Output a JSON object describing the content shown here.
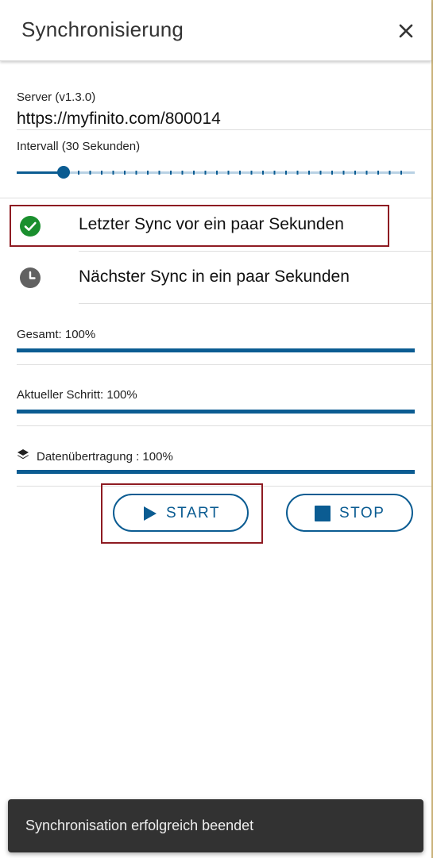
{
  "header": {
    "title": "Synchronisierung",
    "close_icon": "close-icon"
  },
  "server": {
    "label": "Server (v1.3.0)",
    "url": "https://myfinito.com/800014"
  },
  "interval": {
    "label": "Intervall (30 Sekunden)",
    "value_seconds": 30
  },
  "status": {
    "last_sync": {
      "icon": "check-circle-icon",
      "text": "Letzter Sync vor ein paar Sekunden",
      "color": "#1a8f2e"
    },
    "next_sync": {
      "icon": "clock-icon",
      "text": "Nächster Sync in ein paar Sekunden",
      "color": "#616161"
    }
  },
  "progress": {
    "total": {
      "label": "Gesamt: 100%",
      "value": 100
    },
    "current_step": {
      "label": "Aktueller Schritt: 100%",
      "value": 100
    },
    "transfer": {
      "label": "Datenübertragung : 100%",
      "value": 100,
      "icon": "layers-icon"
    }
  },
  "actions": {
    "start": {
      "label": "START",
      "icon": "play-icon"
    },
    "stop": {
      "label": "STOP",
      "icon": "stop-icon"
    }
  },
  "toast": {
    "text": "Synchronisation erfolgreich beendet"
  },
  "colors": {
    "accent": "#0b5c92",
    "highlight": "#8e1b22"
  }
}
